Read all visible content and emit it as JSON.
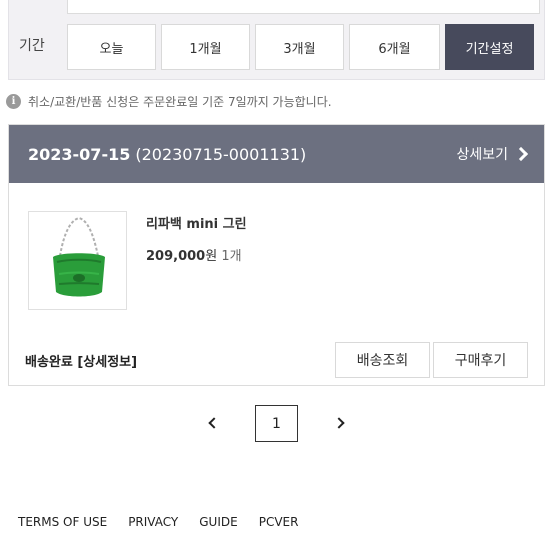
{
  "filter": {
    "period_label": "기간",
    "period_options": [
      "오늘",
      "1개월",
      "3개월",
      "6개월",
      "기간설정"
    ],
    "active_option": "기간설정"
  },
  "notice": {
    "icon": "info-icon",
    "text": "취소/교환/반품 신청은 주문완료일 기준 7일까지 가능합니다."
  },
  "order": {
    "date": "2023-07-15",
    "order_no": "(20230715-0001131)",
    "detail_link": "상세보기",
    "product": {
      "name": "리파백 mini 그린",
      "price": "209,000",
      "price_unit": "원",
      "quantity": "1개",
      "image_color": "#2a9d3a"
    },
    "status": "배송완료 [상세정보]",
    "buttons": {
      "track": "배송조회",
      "review": "구매후기"
    }
  },
  "pagination": {
    "current_page": "1"
  },
  "footer": {
    "links": [
      "TERMS OF USE",
      "PRIVACY",
      "GUIDE",
      "PCVER"
    ]
  },
  "colors": {
    "header_bg": "#6c7080",
    "active_btn": "#474a5c",
    "panel_bg": "#f2f1f4"
  }
}
